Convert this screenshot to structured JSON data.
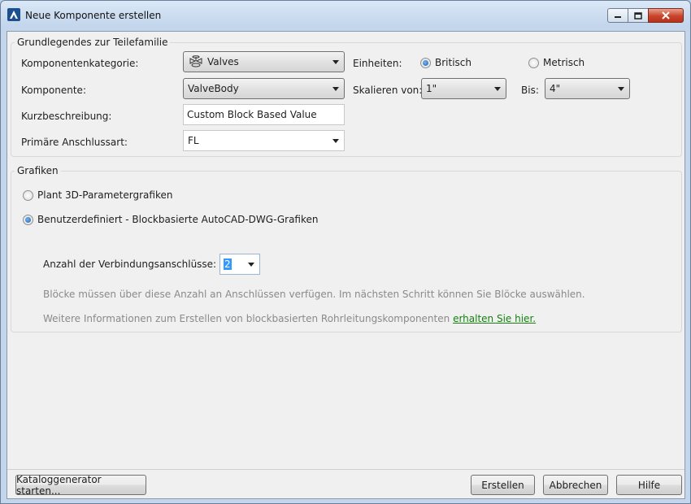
{
  "window": {
    "title": "Neue Komponente erstellen"
  },
  "basic_group": {
    "title": "Grundlegendes zur Teilefamilie",
    "category_label": "Komponentenkategorie:",
    "category_value": "Valves",
    "component_label": "Komponente:",
    "component_value": "ValveBody",
    "description_label": "Kurzbeschreibung:",
    "description_value": "Custom Block Based Value",
    "connection_label": "Primäre Anschlussart:",
    "connection_value": "FL",
    "units_label": "Einheiten:",
    "units_imperial": "Britisch",
    "units_metric": "Metrisch",
    "units_selected": "Britisch",
    "scale_from_label": "Skalieren von:",
    "scale_from_value": "1\"",
    "scale_to_label": "Bis:",
    "scale_to_value": "4\""
  },
  "graphics_group": {
    "title": "Grafiken",
    "option_param": "Plant 3D-Parametergrafiken",
    "option_custom": "Benutzerdefiniert - Blockbasierte AutoCAD-DWG-Grafiken",
    "selected": "Benutzerdefiniert - Blockbasierte AutoCAD-DWG-Grafiken",
    "connections_label": "Anzahl der Verbindungsanschlüsse:",
    "connections_value": "2",
    "info_text": "Blöcke müssen über diese Anzahl an Anschlüssen verfügen. Im nächsten Schritt können Sie Blöcke auswählen.",
    "more_info_text": "Weitere Informationen zum Erstellen von blockbasierten Rohrleitungskomponenten",
    "more_info_link": "erhalten Sie hier."
  },
  "footer": {
    "catalog_button": "Kataloggenerator starten...",
    "create_button": "Erstellen",
    "cancel_button": "Abbrechen",
    "help_button": "Hilfe"
  },
  "colors": {
    "link": "#15820f",
    "selection": "#3399ff",
    "close_button": "#c9442a"
  }
}
